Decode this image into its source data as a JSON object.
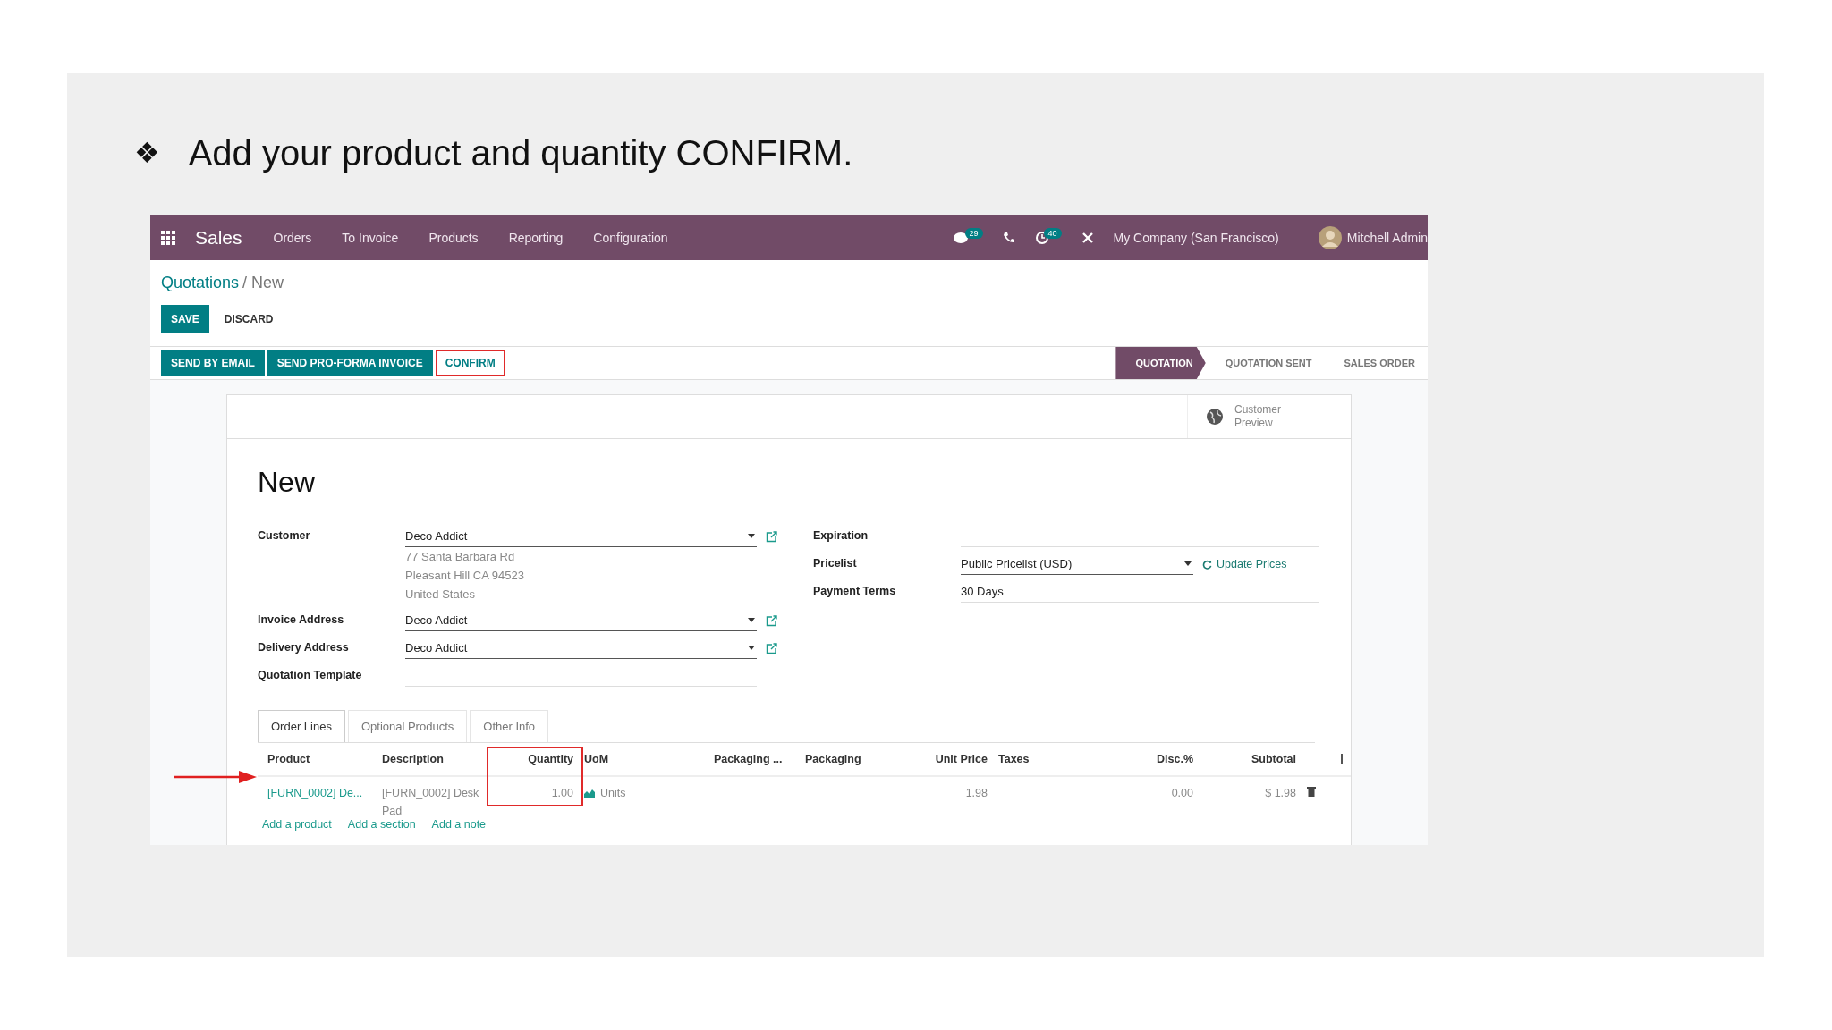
{
  "slide": {
    "bullet": "❖",
    "title": "Add your product and quantity CONFIRM."
  },
  "navbar": {
    "app": "Sales",
    "menu": [
      "Orders",
      "To Invoice",
      "Products",
      "Reporting",
      "Configuration"
    ],
    "chat_count": "29",
    "activity_count": "40",
    "company": "My Company (San Francisco)",
    "user": "Mitchell Admin"
  },
  "breadcrumb": {
    "parent": "Quotations",
    "current": "/ New"
  },
  "buttons": {
    "save": "SAVE",
    "discard": "DISCARD"
  },
  "actions": [
    {
      "label": "SEND BY EMAIL",
      "kind": "primary",
      "highlighted": false
    },
    {
      "label": "SEND PRO-FORMA INVOICE",
      "kind": "primary",
      "highlighted": false
    },
    {
      "label": "CONFIRM",
      "kind": "plain",
      "highlighted": true
    }
  ],
  "stages": [
    {
      "label": "QUOTATION",
      "selected": true
    },
    {
      "label": "QUOTATION SENT",
      "selected": false
    },
    {
      "label": "SALES ORDER",
      "selected": false
    }
  ],
  "preview_button": "Customer Preview",
  "record_title": "New",
  "left_fields": [
    {
      "label": "Customer",
      "value": "Deco Addict",
      "kind": "many2one",
      "address": [
        "77 Santa Barbara Rd",
        "Pleasant Hill CA 94523",
        "United States"
      ]
    },
    {
      "label": "Invoice Address",
      "value": "Deco Addict",
      "kind": "many2one"
    },
    {
      "label": "Delivery Address",
      "value": "Deco Addict",
      "kind": "many2one"
    },
    {
      "label": "Quotation Template",
      "kind": "empty"
    }
  ],
  "right_fields": [
    {
      "label": "Expiration",
      "kind": "empty"
    },
    {
      "label": "Pricelist",
      "value": "Public Pricelist (USD)",
      "kind": "pricelist",
      "action": "Update Prices"
    },
    {
      "label": "Payment Terms",
      "value": "30 Days",
      "kind": "select"
    }
  ],
  "tabs": [
    {
      "label": "Order Lines",
      "selected": true
    },
    {
      "label": "Optional Products",
      "selected": false
    },
    {
      "label": "Other Info",
      "selected": false
    }
  ],
  "columns": [
    {
      "label": "Product",
      "highlighted": false
    },
    {
      "label": "Description",
      "highlighted": false
    },
    {
      "label": "Quantity",
      "highlighted": true
    },
    {
      "label": "UoM",
      "highlighted": false
    },
    {
      "label": "Packaging ...",
      "highlighted": false
    },
    {
      "label": "Packaging",
      "highlighted": false
    },
    {
      "label": "Unit Price",
      "highlighted": false
    },
    {
      "label": "Taxes",
      "highlighted": false
    },
    {
      "label": "Disc.%",
      "highlighted": false
    },
    {
      "label": "Subtotal",
      "highlighted": false
    }
  ],
  "rows": [
    {
      "product": "[FURN_0002] De...",
      "description": "[FURN_0002] Desk Pad",
      "quantity": "1.00",
      "uom": "Units",
      "unit_price": "1.98",
      "discount": "0.00",
      "subtotal": "$ 1.98"
    }
  ],
  "add_links": [
    "Add a product",
    "Add a section",
    "Add a note"
  ]
}
